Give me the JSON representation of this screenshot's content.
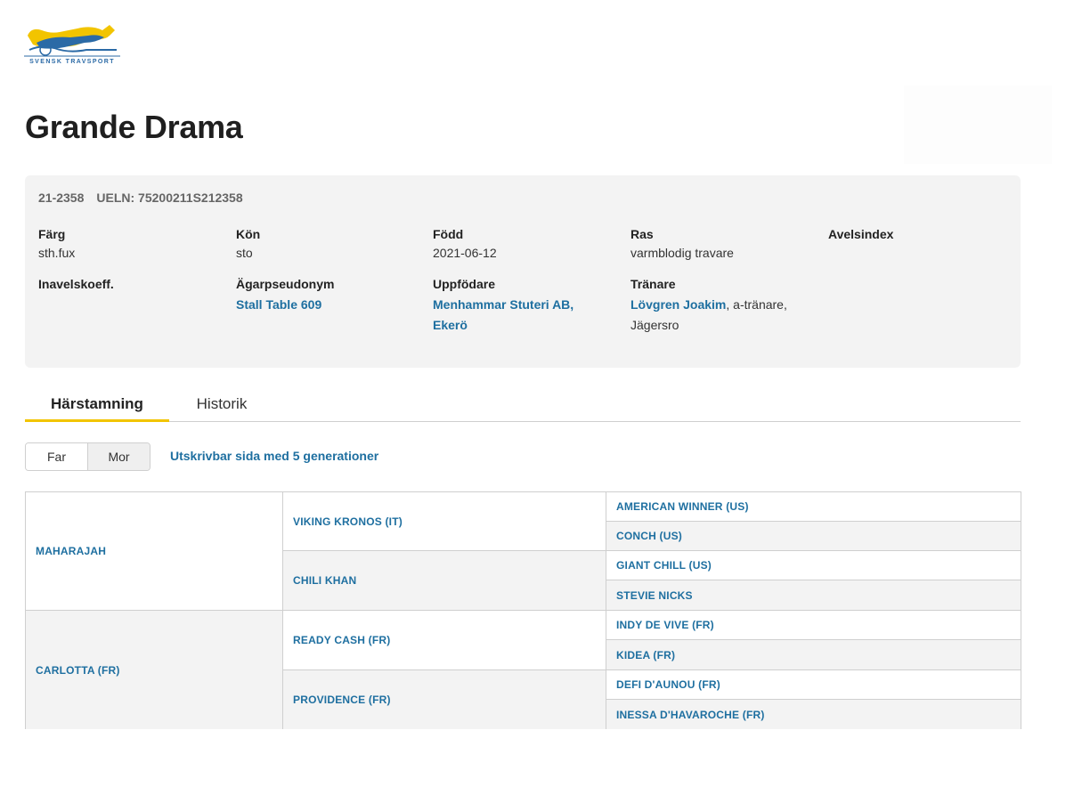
{
  "brand": {
    "name": "SVENSK TRAVSPORT",
    "colors": {
      "yellow": "#f2c400",
      "blue": "#2b6aa6"
    }
  },
  "horse": {
    "name": "Grande Drama",
    "reg_no": "21-2358",
    "ueln": "UELN: 75200211S212358"
  },
  "info": {
    "farg": {
      "label": "Färg",
      "value": "sth.fux"
    },
    "kon": {
      "label": "Kön",
      "value": "sto"
    },
    "fodd": {
      "label": "Född",
      "value": "2021-06-12"
    },
    "ras": {
      "label": "Ras",
      "value": "varmblodig travare"
    },
    "avelsindex": {
      "label": "Avelsindex",
      "value": ""
    },
    "inavelskoeff": {
      "label": "Inavelskoeff.",
      "value": ""
    },
    "agarpseudonym": {
      "label": "Ägarpseudonym",
      "value": "Stall Table 609"
    },
    "uppfodare": {
      "label": "Uppfödare",
      "value": "Menhammar Stuteri AB, Ekerö"
    },
    "tranare": {
      "label": "Tränare",
      "name": "Lövgren Joakim",
      "suffix": ", a-tränare, Jägersro"
    }
  },
  "tabs": [
    {
      "label": "Härstamning",
      "active": true
    },
    {
      "label": "Historik",
      "active": false
    }
  ],
  "toggle": {
    "far": "Far",
    "mor": "Mor"
  },
  "print_link": "Utskrivbar sida med 5 generationer",
  "pedigree": {
    "gen1": [
      "MAHARAJAH",
      "CARLOTTA (FR)"
    ],
    "gen2": [
      "VIKING KRONOS (IT)",
      "CHILI KHAN",
      "READY CASH (FR)",
      "PROVIDENCE (FR)"
    ],
    "gen3": [
      "AMERICAN WINNER (US)",
      "CONCH (US)",
      "GIANT CHILL (US)",
      "STEVIE NICKS",
      "INDY DE VIVE (FR)",
      "KIDEA (FR)",
      "DEFI D'AUNOU (FR)",
      "INESSA D'HAVAROCHE (FR)"
    ]
  }
}
